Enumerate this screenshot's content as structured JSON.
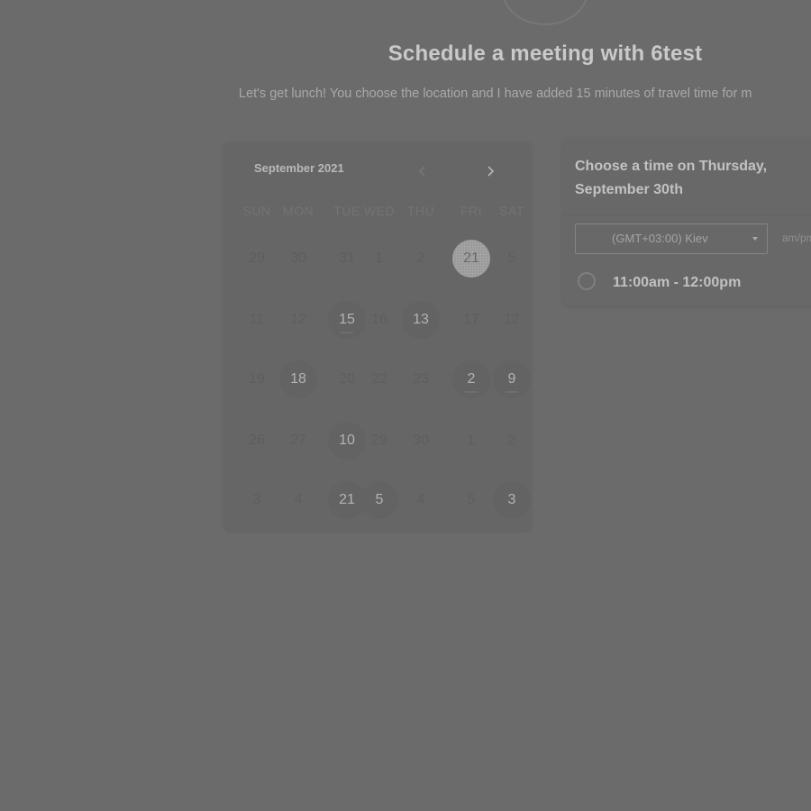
{
  "page": {
    "title": "Schedule a meeting with 6test",
    "description": "Let's get lunch! You choose the location and I have added 15 minutes of travel time for m"
  },
  "calendar": {
    "month_label": "September 2021",
    "prev_icon": "chevron-left-icon",
    "next_icon": "chevron-right-icon",
    "weekdays": [
      "SUN",
      "MON",
      "TUE",
      "WED",
      "THU",
      "FRI",
      "SAT"
    ],
    "days": [
      {
        "label": "29",
        "state": "disabled"
      },
      {
        "label": "30",
        "state": "disabled"
      },
      {
        "label": "31",
        "state": "disabled"
      },
      {
        "label": "1",
        "state": "disabled"
      },
      {
        "label": "2",
        "state": "disabled"
      },
      {
        "label": "21",
        "state": "selected"
      },
      {
        "label": "5",
        "state": "disabled"
      },
      {
        "label": "11",
        "state": "disabled"
      },
      {
        "label": "12",
        "state": "disabled"
      },
      {
        "label": "15",
        "state": "available",
        "dot": true
      },
      {
        "label": "16",
        "state": "disabled"
      },
      {
        "label": "13",
        "state": "available"
      },
      {
        "label": "17",
        "state": "disabled"
      },
      {
        "label": "12",
        "state": "disabled"
      },
      {
        "label": "19",
        "state": "disabled"
      },
      {
        "label": "18",
        "state": "available"
      },
      {
        "label": "20",
        "state": "disabled"
      },
      {
        "label": "22",
        "state": "disabled"
      },
      {
        "label": "23",
        "state": "disabled"
      },
      {
        "label": "2",
        "state": "available",
        "dot": true
      },
      {
        "label": "9",
        "state": "available",
        "dot": true
      },
      {
        "label": "26",
        "state": "disabled"
      },
      {
        "label": "27",
        "state": "disabled"
      },
      {
        "label": "10",
        "state": "available"
      },
      {
        "label": "29",
        "state": "disabled"
      },
      {
        "label": "30",
        "state": "disabled"
      },
      {
        "label": "1",
        "state": "disabled"
      },
      {
        "label": "2",
        "state": "disabled"
      },
      {
        "label": "3",
        "state": "disabled"
      },
      {
        "label": "4",
        "state": "disabled"
      },
      {
        "label": "21",
        "state": "available"
      },
      {
        "label": "5",
        "state": "available"
      },
      {
        "label": "4",
        "state": "disabled"
      },
      {
        "label": "5",
        "state": "disabled"
      },
      {
        "label": "3",
        "state": "available"
      }
    ]
  },
  "panel": {
    "title": "Choose a time on Thursday, September 30th",
    "timezone": "(GMT+03:00) Kiev",
    "format_toggle": "am/pm",
    "slot_label": "11:00am - 12:00pm"
  },
  "colors": {
    "overlay_background": "#6b6b6b",
    "selected_day": "#9a9a9a",
    "available_day": "#636363"
  }
}
